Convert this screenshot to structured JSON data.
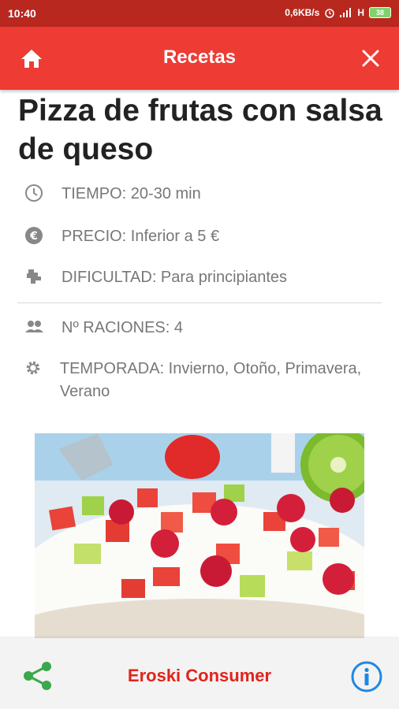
{
  "status": {
    "time": "10:40",
    "speed": "0,6KB/s",
    "network": "H",
    "battery": "38"
  },
  "appbar": {
    "title": "Recetas",
    "home_icon": "home-icon",
    "close_icon": "close-icon"
  },
  "recipe": {
    "title": "Pizza de frutas con salsa de queso",
    "info": [
      {
        "icon": "clock-icon",
        "text": "TIEMPO: 20-30 min"
      },
      {
        "icon": "euro-icon",
        "text": "PRECIO: Inferior a 5 €"
      },
      {
        "icon": "difficulty-icon",
        "text": "DIFICULTAD: Para principiantes"
      }
    ],
    "info2": [
      {
        "icon": "people-icon",
        "text": "Nº RACIONES: 4"
      },
      {
        "icon": "gear-icon",
        "text": "TEMPORADA: Invierno, Otoño, Primavera, Verano"
      }
    ]
  },
  "footer": {
    "brand": "Eroski Consumer"
  },
  "colors": {
    "appbar": "#ee3b33",
    "statusbar": "#b8281f",
    "brand": "#e2231a",
    "share": "#3aa84b",
    "info": "#1e88e5"
  }
}
